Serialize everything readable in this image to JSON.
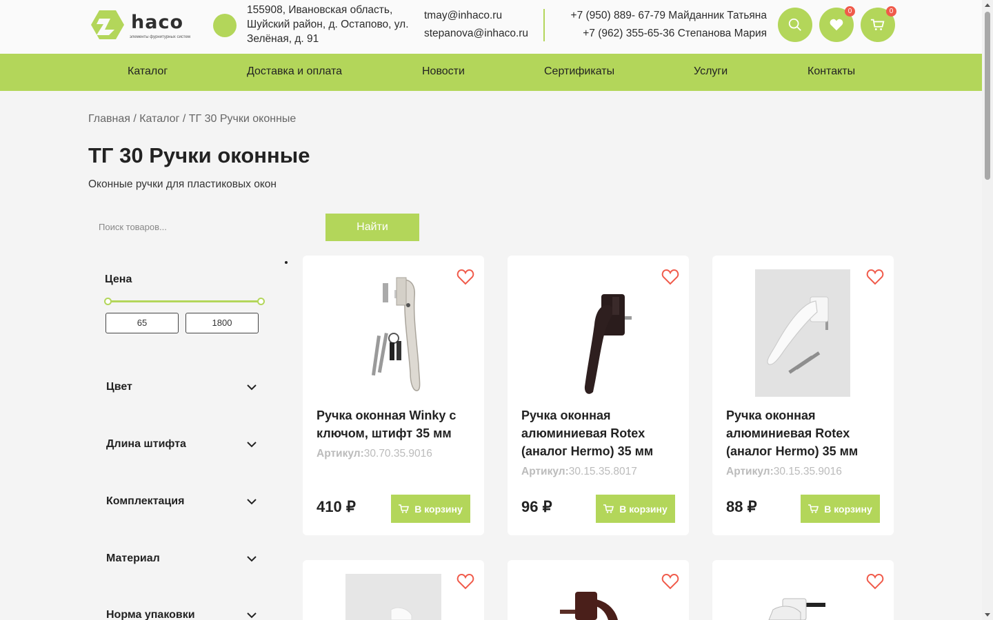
{
  "header": {
    "logo_text": "haco",
    "logo_tagline": "элементы фурнитурных систем",
    "address": "155908, Ивановская область, Шуйский район, д. Остапово, ул. Зелёная, д. 91",
    "emails": [
      "tmay@inhaco.ru",
      "stepanova@inhaco.ru"
    ],
    "phones": [
      "+7 (950) 889- 67-79 Майданник Татьяна",
      "+7 (962) 355-65-36 Степанова Мария"
    ],
    "favorites_count": "0",
    "cart_count": "0"
  },
  "nav": [
    "Каталог",
    "Доставка и оплата",
    "Новости",
    "Сертификаты",
    "Услуги",
    "Контакты"
  ],
  "breadcrumb": "Главная / Каталог / ТГ 30 Ручки оконные",
  "page": {
    "title": "ТГ 30 Ручки оконные",
    "subtitle": "Оконные ручки для пластиковых окон"
  },
  "search": {
    "placeholder": "Поиск товаров...",
    "button": "Найти"
  },
  "filters": {
    "price_title": "Цена",
    "price_min": "65",
    "price_max": "1800",
    "groups": [
      "Цвет",
      "Длина штифта",
      "Комплектация",
      "Материал",
      "Норма упаковки"
    ]
  },
  "products": [
    {
      "title": "Ручка оконная Winky с ключом, штифт 35 мм",
      "sku_label": "Артикул:",
      "sku": "30.70.35.9016",
      "price": "410 ₽",
      "cart": "В корзину",
      "image": "white-handle-with-key"
    },
    {
      "title": "Ручка оконная алюминиевая Rotex (аналог Hermo) 35 мм",
      "sku_label": "Артикул:",
      "sku": "30.15.35.8017",
      "price": "96 ₽",
      "cart": "В корзину",
      "image": "brown-handle"
    },
    {
      "title": "Ручка оконная алюминиевая Rotex (аналог Hermo) 35 мм",
      "sku_label": "Артикул:",
      "sku": "30.15.35.9016",
      "price": "88 ₽",
      "cart": "В корзину",
      "image": "white-handle-grey-bg"
    }
  ],
  "colors": {
    "accent": "#b3d65a",
    "badge": "#f05a4a",
    "heart": "#f05a4a"
  }
}
